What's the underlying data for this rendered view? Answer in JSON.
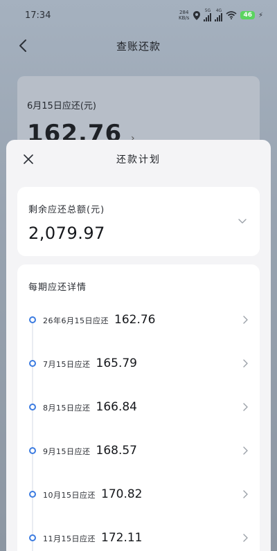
{
  "status_bar": {
    "time": "17:34",
    "net_speed": "284",
    "net_speed_unit": "KB/s",
    "sim1_label": "5G",
    "sim2_label": "4G",
    "battery": "46"
  },
  "nav": {
    "title": "查账还款"
  },
  "background_card": {
    "label": "6月15日应还(元)",
    "amount": "162.76",
    "chevron": "›"
  },
  "sheet": {
    "title": "还款计划",
    "total_label": "剩余应还总额(元)",
    "total_amount": "2,079.97",
    "plan_title": "每期应还详情",
    "items": [
      {
        "date": "26年6月15日应还",
        "amount": "162.76"
      },
      {
        "date": "7月15日应还",
        "amount": "165.79"
      },
      {
        "date": "8月15日应还",
        "amount": "166.84"
      },
      {
        "date": "9月15日应还",
        "amount": "168.57"
      },
      {
        "date": "10月15日应还",
        "amount": "170.82"
      },
      {
        "date": "11月15日应还",
        "amount": "172.11"
      }
    ]
  },
  "colors": {
    "accent": "#3b7be0",
    "battery": "#5bd45f"
  }
}
